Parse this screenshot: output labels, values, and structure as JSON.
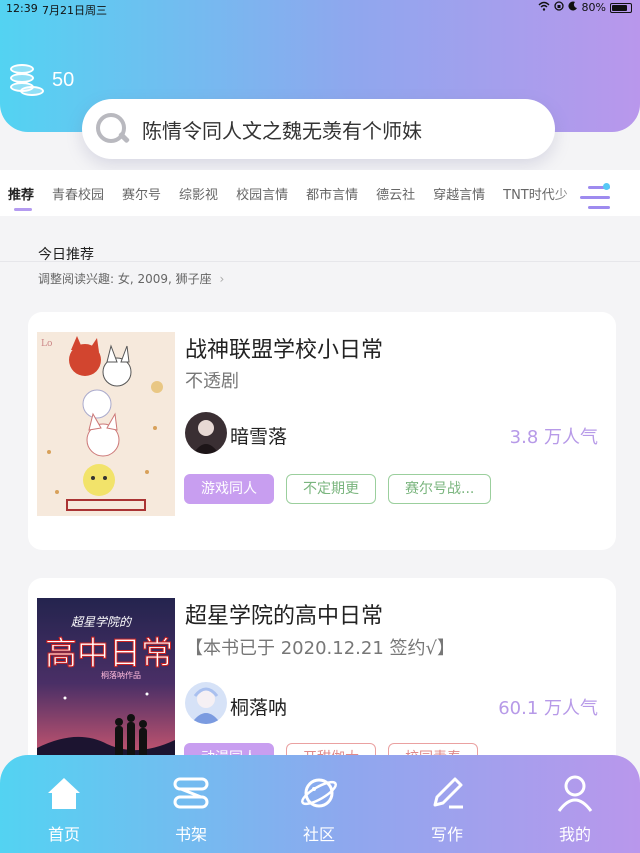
{
  "status_bar": {
    "time": "12:39",
    "date": "7月21日周三",
    "battery": "80%"
  },
  "header": {
    "coin_count": "50",
    "search_text": "陈情令同人文之魏无羡有个师妹"
  },
  "tabs": [
    {
      "label": "推荐",
      "active": true
    },
    {
      "label": "青春校园"
    },
    {
      "label": "赛尔号"
    },
    {
      "label": "综影视"
    },
    {
      "label": "校园言情"
    },
    {
      "label": "都市言情"
    },
    {
      "label": "德云社"
    },
    {
      "label": "穿越言情"
    },
    {
      "label": "TNT时代少"
    }
  ],
  "section": {
    "title": "今日推荐",
    "subtitle": "调整阅读兴趣: 女, 2009, 狮子座"
  },
  "books": [
    {
      "title": "战神联盟学校小日常",
      "description": "不透剧",
      "author": "暗雪落",
      "popularity": "3.8 万人气",
      "tags": [
        "游戏同人",
        "不定期更",
        "赛尔号战..."
      ]
    },
    {
      "title": "超星学院的高中日常",
      "description": "【本书已于 2020.12.21 签约√】",
      "author": "桐落呐",
      "popularity": "60.1 万人气",
      "tags": [
        "动漫同人",
        "开甜伽大",
        "校园青春"
      ]
    }
  ],
  "bottom_nav": [
    {
      "label": "首页",
      "icon": "home-icon"
    },
    {
      "label": "书架",
      "icon": "bookshelf-icon"
    },
    {
      "label": "社区",
      "icon": "planet-icon"
    },
    {
      "label": "写作",
      "icon": "pen-icon"
    },
    {
      "label": "我的",
      "icon": "user-icon"
    }
  ],
  "colors": {
    "gradient_start": "#53d3f2",
    "gradient_end": "#b997ec",
    "accent": "#b79ae8"
  }
}
